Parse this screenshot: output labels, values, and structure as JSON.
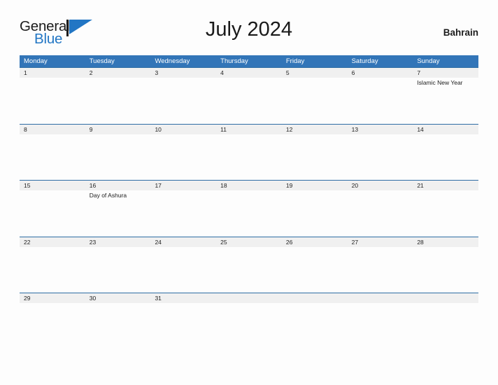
{
  "brand": {
    "name_part1": "General",
    "name_part2": "Blue",
    "flag_icon": "blue-flag-icon",
    "color_blue": "#2276c4",
    "color_dark": "#1c1c1c"
  },
  "header": {
    "title": "July 2024",
    "country": "Bahrain"
  },
  "theme": {
    "header_blue": "#3275b8",
    "row_border_blue": "#2e6da4",
    "date_band_gray": "#f0f0f0",
    "page_background": "#fdfdfd"
  },
  "calendar": {
    "weekdays": [
      "Monday",
      "Tuesday",
      "Wednesday",
      "Thursday",
      "Friday",
      "Saturday",
      "Sunday"
    ],
    "weeks": [
      {
        "days": [
          {
            "date": "1",
            "event": ""
          },
          {
            "date": "2",
            "event": ""
          },
          {
            "date": "3",
            "event": ""
          },
          {
            "date": "4",
            "event": ""
          },
          {
            "date": "5",
            "event": ""
          },
          {
            "date": "6",
            "event": ""
          },
          {
            "date": "7",
            "event": "Islamic New Year"
          }
        ]
      },
      {
        "days": [
          {
            "date": "8",
            "event": ""
          },
          {
            "date": "9",
            "event": ""
          },
          {
            "date": "10",
            "event": ""
          },
          {
            "date": "11",
            "event": ""
          },
          {
            "date": "12",
            "event": ""
          },
          {
            "date": "13",
            "event": ""
          },
          {
            "date": "14",
            "event": ""
          }
        ]
      },
      {
        "days": [
          {
            "date": "15",
            "event": ""
          },
          {
            "date": "16",
            "event": "Day of Ashura"
          },
          {
            "date": "17",
            "event": ""
          },
          {
            "date": "18",
            "event": ""
          },
          {
            "date": "19",
            "event": ""
          },
          {
            "date": "20",
            "event": ""
          },
          {
            "date": "21",
            "event": ""
          }
        ]
      },
      {
        "days": [
          {
            "date": "22",
            "event": ""
          },
          {
            "date": "23",
            "event": ""
          },
          {
            "date": "24",
            "event": ""
          },
          {
            "date": "25",
            "event": ""
          },
          {
            "date": "26",
            "event": ""
          },
          {
            "date": "27",
            "event": ""
          },
          {
            "date": "28",
            "event": ""
          }
        ]
      },
      {
        "days": [
          {
            "date": "29",
            "event": ""
          },
          {
            "date": "30",
            "event": ""
          },
          {
            "date": "31",
            "event": ""
          },
          {
            "date": "",
            "event": ""
          },
          {
            "date": "",
            "event": ""
          },
          {
            "date": "",
            "event": ""
          },
          {
            "date": "",
            "event": ""
          }
        ]
      }
    ]
  }
}
